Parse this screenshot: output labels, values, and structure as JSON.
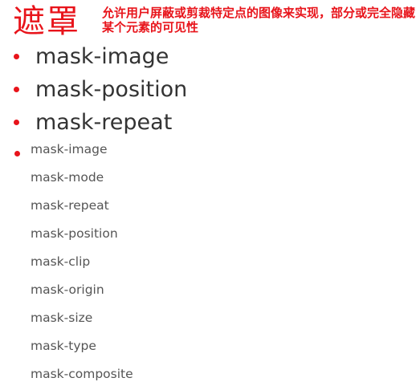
{
  "header": {
    "title": "遮罩",
    "description": "允许用户屏蔽或剪裁特定点的图像来实现，部分或完全隐藏某个元素的可见性"
  },
  "main_items": [
    "mask-image",
    "mask-position",
    "mask-repeat"
  ],
  "sub_items": [
    "mask-image",
    "mask-mode",
    "mask-repeat",
    "mask-position",
    "mask-clip",
    "mask-origin",
    "mask-size",
    "mask-type",
    "mask-composite"
  ],
  "colors": {
    "accent": "#e8141b",
    "text_main": "#333333",
    "text_sub": "#555555"
  }
}
